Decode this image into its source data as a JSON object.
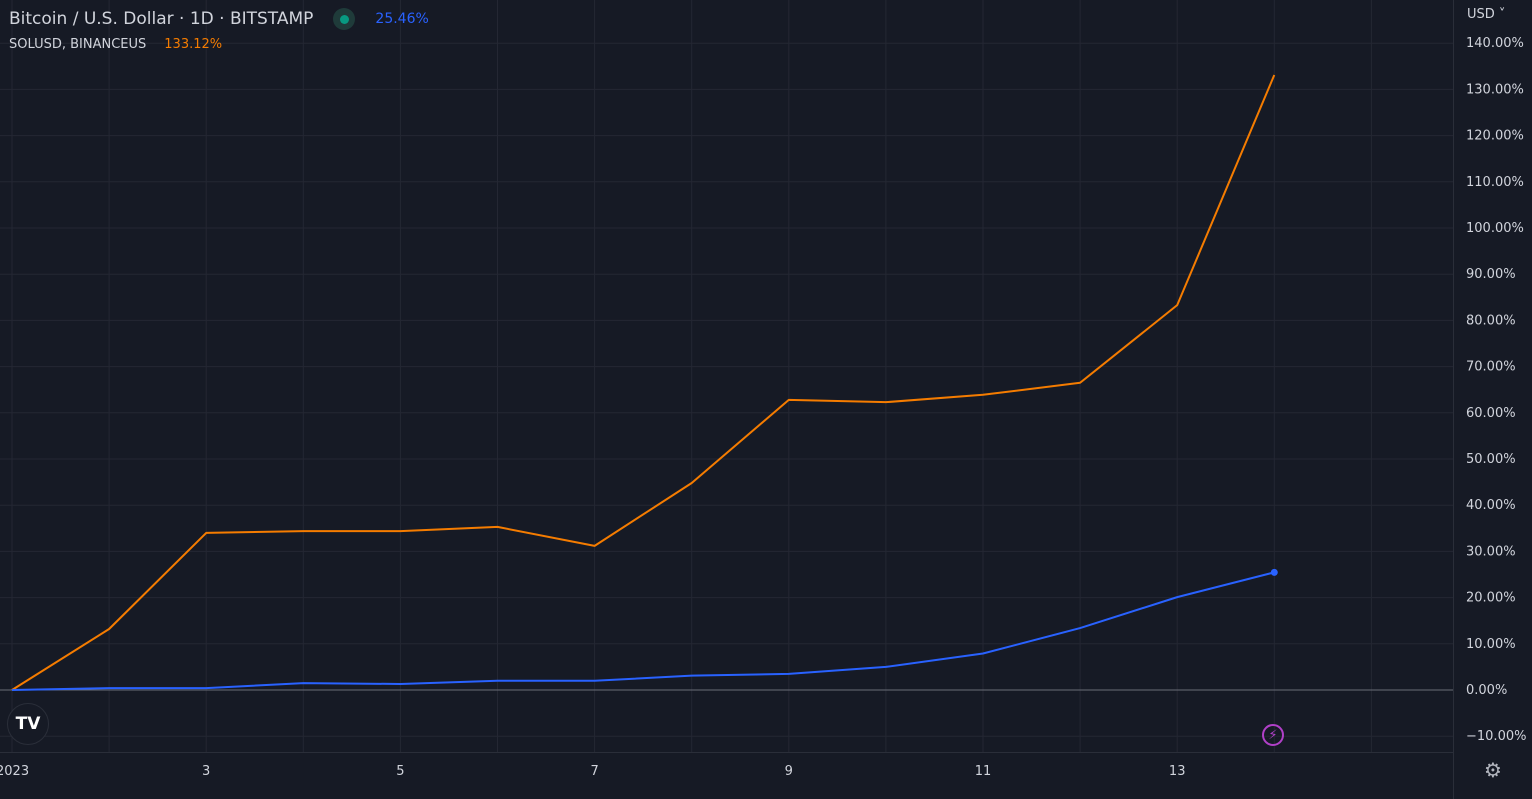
{
  "legend": {
    "main_title": "Bitcoin / U.S. Dollar · 1D · BITSTAMP",
    "main_value": "25.46%",
    "compare_title": "SOLUSD, BINANCEUS",
    "compare_value": "133.12%"
  },
  "axis": {
    "currency_label": "USD"
  },
  "icons": {
    "logo": "tradingview-logo-icon",
    "logo_text": "TV",
    "bolt": "lightning-icon",
    "settings": "gear-icon"
  },
  "chart_data": {
    "type": "line",
    "title": "Bitcoin / U.S. Dollar · 1D · BITSTAMP",
    "x": [
      1,
      2,
      3,
      4,
      5,
      6,
      7,
      8,
      9,
      10,
      11,
      12,
      13,
      14
    ],
    "x_tick_values": [
      1,
      3,
      5,
      7,
      9,
      11,
      13
    ],
    "x_tick_labels": [
      "2023",
      "3",
      "5",
      "7",
      "9",
      "11",
      "13"
    ],
    "y_ticks": [
      140,
      130,
      120,
      110,
      100,
      90,
      80,
      70,
      60,
      50,
      40,
      30,
      20,
      10,
      0,
      -10
    ],
    "y_tick_labels": [
      "140.00%",
      "130.00%",
      "120.00%",
      "110.00%",
      "100.00%",
      "90.00%",
      "80.00%",
      "70.00%",
      "60.00%",
      "50.00%",
      "40.00%",
      "30.00%",
      "20.00%",
      "10.00%",
      "0.00%",
      "−10.00%"
    ],
    "ylim": [
      -13,
      150
    ],
    "xlim": [
      0.88,
      15.83
    ],
    "ylabel": "%",
    "grid": true,
    "series": [
      {
        "name": "SOLUSD, BINANCEUS",
        "color": "#f57c00",
        "values": [
          0,
          13.2,
          34.0,
          34.4,
          34.4,
          35.3,
          31.2,
          44.8,
          62.8,
          62.3,
          63.9,
          66.5,
          83.3,
          133.12
        ]
      },
      {
        "name": "Bitcoin / U.S. Dollar",
        "color": "#2962ff",
        "values": [
          0,
          0.4,
          0.4,
          1.5,
          1.3,
          2.0,
          2.0,
          3.1,
          3.5,
          5.0,
          7.9,
          13.4,
          20.1,
          25.46
        ]
      }
    ]
  }
}
